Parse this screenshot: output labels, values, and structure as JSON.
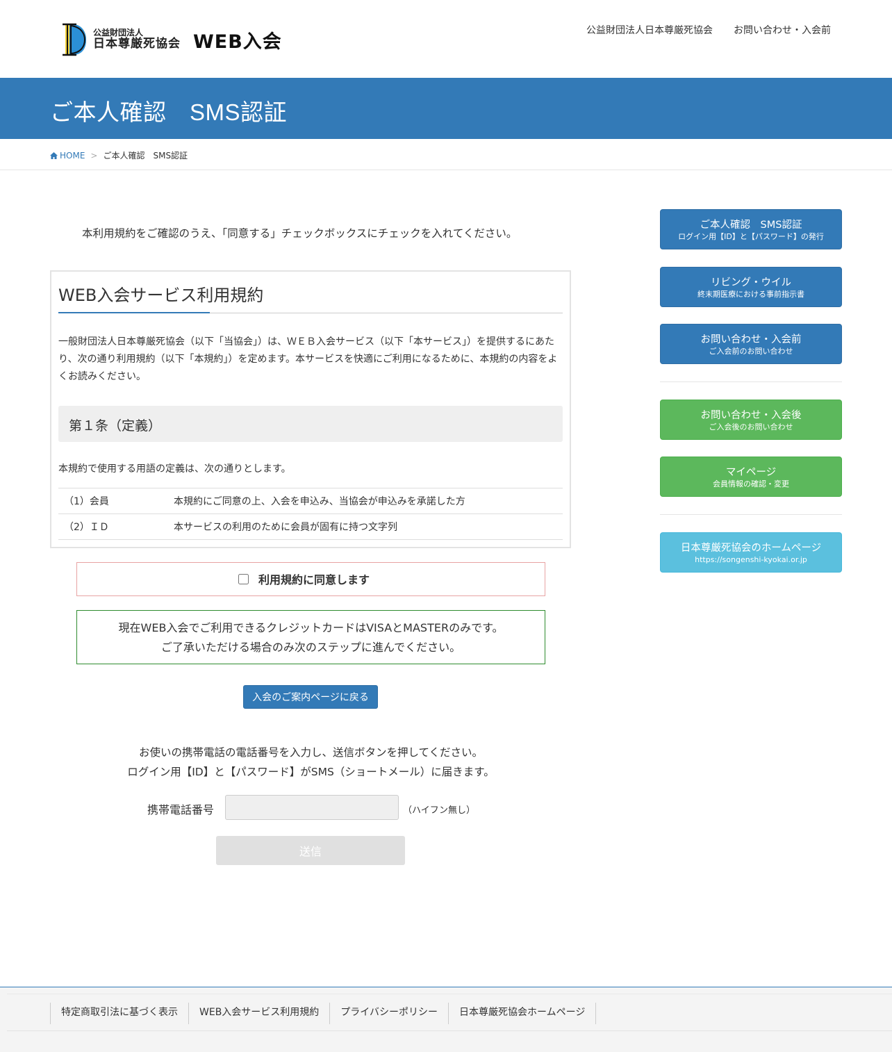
{
  "header": {
    "logo_small": "公益財団法人",
    "logo_main": "日本尊厳死協会",
    "logo_web": "WEB入会",
    "nav": [
      "公益財団法人日本尊厳死協会",
      "お問い合わせ・入会前"
    ]
  },
  "page_title": "ご本人確認　SMS認証",
  "breadcrumb": {
    "home": "HOME",
    "separator": ">",
    "current": "ご本人確認　SMS認証"
  },
  "intro": "本利用規約をご確認のうえ、「同意する」チェックボックスにチェックを入れてください。",
  "terms": {
    "title": "WEB入会サービス利用規約",
    "body": "一般財団法人日本尊厳死協会（以下「当協会」）は、ＷＥＢ入会サービス（以下「本サービス」）を提供するにあたり、次の通り利用規約（以下「本規約」）を定めます。本サービスを快適にご利用になるために、本規約の内容をよくお読みください。",
    "article_title": "第１条（定義）",
    "article_intro": "本規約で使用する用語の定義は、次の通りとします。",
    "definitions": [
      {
        "term": "（1）会員",
        "desc": "本規約にご同意の上、入会を申込み、当協会が申込みを承諾した方"
      },
      {
        "term": "（2）ＩＤ",
        "desc": "本サービスの利用のために会員が固有に持つ文字列"
      }
    ]
  },
  "agree_label": "利用規約に同意します",
  "notice": {
    "line1": "現在WEB入会でご利用できるクレジットカードはVISAとMASTERのみです。",
    "line2": "ご了承いただける場合のみ次のステップに進んでください。"
  },
  "back_button": "入会のご案内ページに戻る",
  "sms": {
    "line1": "お使いの携帯電話の電話番号を入力し、送信ボタンを押してください。",
    "line2": "ログイン用【ID】と【パスワード】がSMS（ショートメール）に届きます。",
    "phone_label": "携帯電話番号",
    "phone_value": "",
    "phone_hint": "（ハイフン無し）",
    "send_button": "送信"
  },
  "sidebar": [
    {
      "main": "ご本人確認　SMS認証",
      "sub": "ログイン用【ID】と【パスワード】の発行",
      "color": "#337ab7"
    },
    {
      "main": "リビング・ウイル",
      "sub": "終末期医療における事前指示書",
      "color": "#337ab7"
    },
    {
      "main": "お問い合わせ・入会前",
      "sub": "ご入会前のお問い合わせ",
      "color": "#337ab7"
    },
    {
      "main": "お問い合わせ・入会後",
      "sub": "ご入会後のお問い合わせ",
      "color": "#5cb85c"
    },
    {
      "main": "マイページ",
      "sub": "会員情報の確認・変更",
      "color": "#5cb85c"
    },
    {
      "main": "日本尊厳死協会のホームページ",
      "sub": "https://songenshi-kyokai.or.jp",
      "color": "#5bc0de"
    }
  ],
  "footer": [
    "特定商取引法に基づく表示",
    "WEB入会サービス利用規約",
    "プライバシーポリシー",
    "日本尊厳死協会ホームページ"
  ]
}
